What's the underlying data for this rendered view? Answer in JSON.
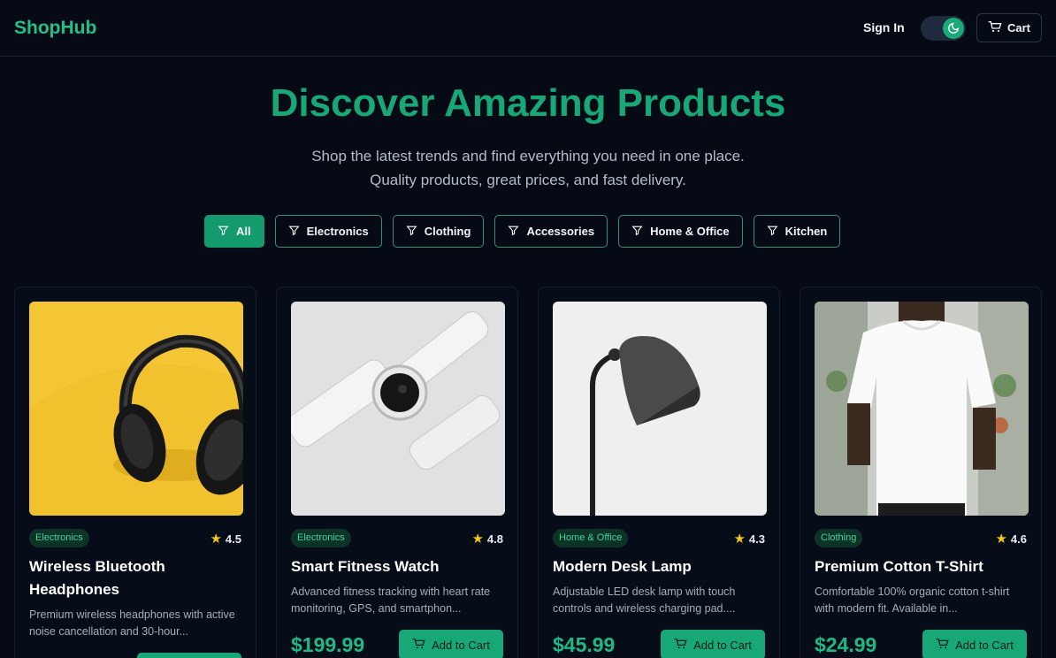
{
  "header": {
    "logo": "ShopHub",
    "sign_in": "Sign In",
    "cart_label": "Cart"
  },
  "hero": {
    "title": "Discover Amazing Products",
    "subtitle_line1": "Shop the latest trends and find everything you need in one place.",
    "subtitle_line2": "Quality products, great prices, and fast delivery."
  },
  "filters": [
    "All",
    "Electronics",
    "Clothing",
    "Accessories",
    "Home & Office",
    "Kitchen"
  ],
  "products": [
    {
      "category": "Electronics",
      "rating": "4.5",
      "name": "Wireless Bluetooth Headphones",
      "description": "Premium wireless headphones with active noise cancellation and 30-hour...",
      "price": "",
      "button": ""
    },
    {
      "category": "Electronics",
      "rating": "4.8",
      "name": "Smart Fitness Watch",
      "description": "Advanced fitness tracking with heart rate monitoring, GPS, and smartphon...",
      "price": "$199.99",
      "button": "Add to Cart"
    },
    {
      "category": "Home & Office",
      "rating": "4.3",
      "name": "Modern Desk Lamp",
      "description": "Adjustable LED desk lamp with touch controls and wireless charging pad....",
      "price": "$45.99",
      "button": "Add to Cart"
    },
    {
      "category": "Clothing",
      "rating": "4.6",
      "name": "Premium Cotton T-Shirt",
      "description": "Comfortable 100% organic cotton t-shirt with modern fit. Available in...",
      "price": "$24.99",
      "button": "Add to Cart"
    }
  ],
  "colors": {
    "accent": "#18a877",
    "background": "#050a14"
  }
}
